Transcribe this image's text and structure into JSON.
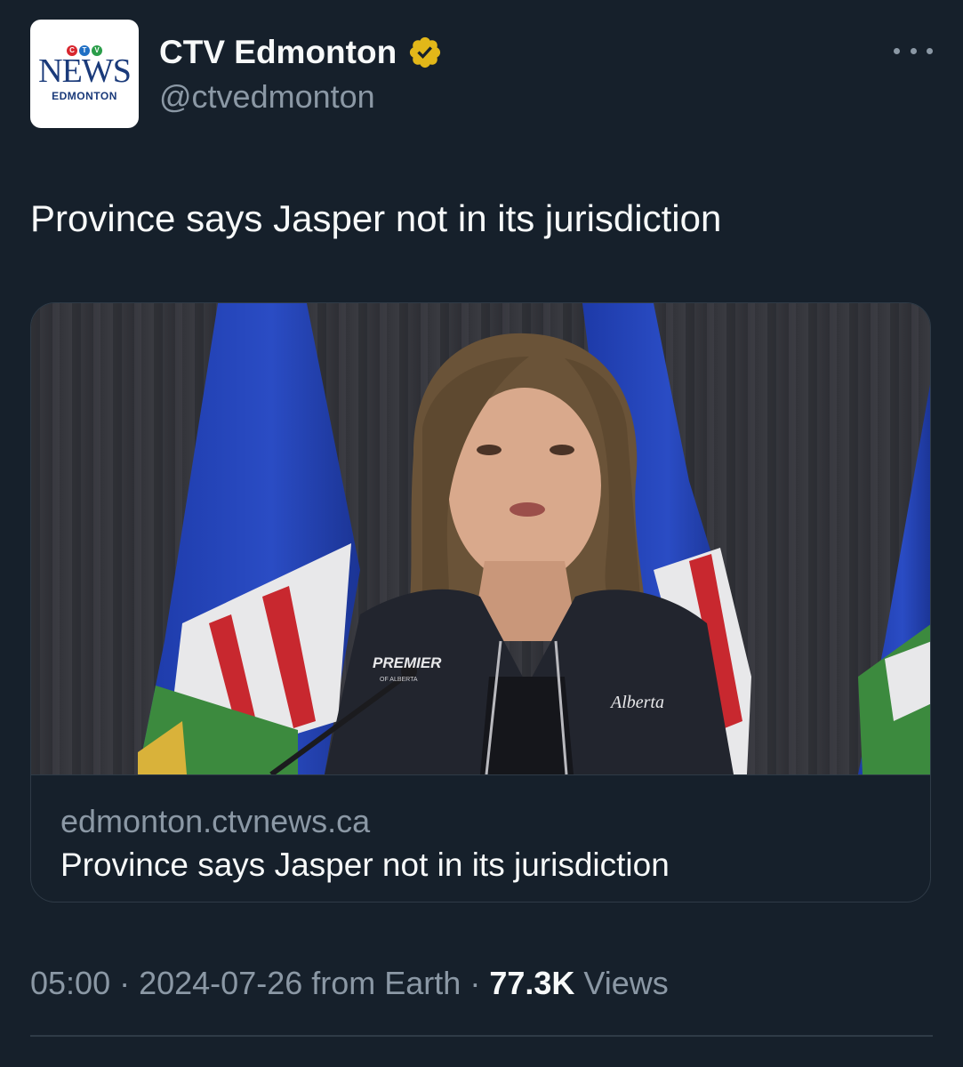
{
  "account": {
    "display_name": "CTV Edmonton",
    "handle": "@ctvedmonton",
    "avatar_logo": {
      "brand": "CTV",
      "wordmark": "NEWS",
      "city": "EDMONTON"
    },
    "verified_icon": "verified-badge-icon"
  },
  "post": {
    "text": "Province says Jasper not in its jurisdiction"
  },
  "link_card": {
    "domain": "edmonton.ctvnews.ca",
    "title": "Province says Jasper not in its jurisdiction",
    "image_jacket_text": "PREMIER",
    "image_jacket_subtext": "OF ALBERTA",
    "image_brand_text": "Alberta"
  },
  "meta": {
    "time": "05:00",
    "separator": " · ",
    "date": "2024-07-26",
    "source": "from Earth",
    "views_count": "77.3K",
    "views_label": "Views"
  },
  "colors": {
    "background": "#16202b",
    "primary_text": "#f7f9f9",
    "secondary_text": "#8b98a5",
    "border": "#2f3b47",
    "verified_gold": "#e2b719"
  },
  "icons": {
    "more": "more-horizontal-icon"
  }
}
